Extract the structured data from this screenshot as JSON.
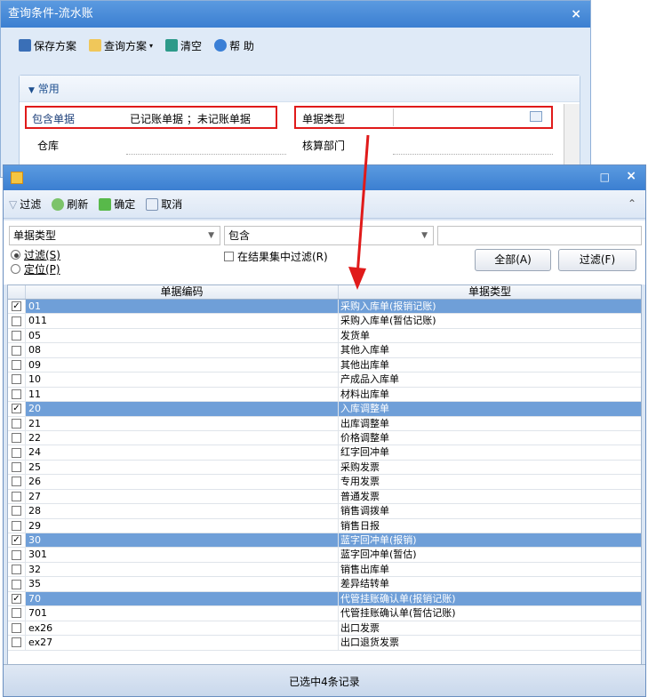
{
  "back_window": {
    "title": "查询条件-流水账",
    "close": "×",
    "toolbar": {
      "save_scheme": "保存方案",
      "query_scheme": "查询方案",
      "clear": "清空",
      "help": "帮 助"
    },
    "panel_title": "常用",
    "fields": {
      "include_docs_label": "包含单据",
      "include_docs_value": "已记账单据 ；未记账单据",
      "doc_type_label": "单据类型",
      "doc_type_value": "",
      "warehouse_label": "仓库",
      "dept_label": "核算部门"
    }
  },
  "dialog": {
    "maximize": "□",
    "close": "×",
    "toolbar": {
      "filter": "过滤",
      "refresh": "刷新",
      "confirm": "确定",
      "cancel": "取消"
    },
    "field_select": "单据类型",
    "op_select": "包含",
    "value_input": "",
    "radio_filter": "过滤(S)",
    "radio_locate": "定位(P)",
    "filter_in_result": "在结果集中过滤(R)",
    "btn_all": "全部(A)",
    "btn_filter": "过滤(F)",
    "columns": [
      "单据编码",
      "单据类型"
    ],
    "rows": [
      {
        "code": "01",
        "type": "采购入库单(报销记账)",
        "checked": true
      },
      {
        "code": "011",
        "type": "采购入库单(暂估记账)",
        "checked": false
      },
      {
        "code": "05",
        "type": "发货单",
        "checked": false
      },
      {
        "code": "08",
        "type": "其他入库单",
        "checked": false
      },
      {
        "code": "09",
        "type": "其他出库单",
        "checked": false
      },
      {
        "code": "10",
        "type": "产成品入库单",
        "checked": false
      },
      {
        "code": "11",
        "type": "材料出库单",
        "checked": false
      },
      {
        "code": "20",
        "type": "入库调整单",
        "checked": true
      },
      {
        "code": "21",
        "type": "出库调整单",
        "checked": false
      },
      {
        "code": "22",
        "type": "价格调整单",
        "checked": false
      },
      {
        "code": "24",
        "type": "红字回冲单",
        "checked": false
      },
      {
        "code": "25",
        "type": "采购发票",
        "checked": false
      },
      {
        "code": "26",
        "type": "专用发票",
        "checked": false
      },
      {
        "code": "27",
        "type": "普通发票",
        "checked": false
      },
      {
        "code": "28",
        "type": "销售调拨单",
        "checked": false
      },
      {
        "code": "29",
        "type": "销售日报",
        "checked": false
      },
      {
        "code": "30",
        "type": "蓝字回冲单(报销)",
        "checked": true
      },
      {
        "code": "301",
        "type": "蓝字回冲单(暂估)",
        "checked": false
      },
      {
        "code": "32",
        "type": "销售出库单",
        "checked": false
      },
      {
        "code": "35",
        "type": "差异结转单",
        "checked": false
      },
      {
        "code": "70",
        "type": "代管挂账确认单(报销记账)",
        "checked": true
      },
      {
        "code": "701",
        "type": "代管挂账确认单(暂估记账)",
        "checked": false
      },
      {
        "code": "ex26",
        "type": "出口发票",
        "checked": false
      },
      {
        "code": "ex27",
        "type": "出口退货发票",
        "checked": false
      }
    ],
    "status": "已选中4条记录"
  },
  "colors": {
    "title_blue": "#3b7fd1",
    "selected_row": "#6f9fd8",
    "highlight_red": "#e01a1a"
  }
}
